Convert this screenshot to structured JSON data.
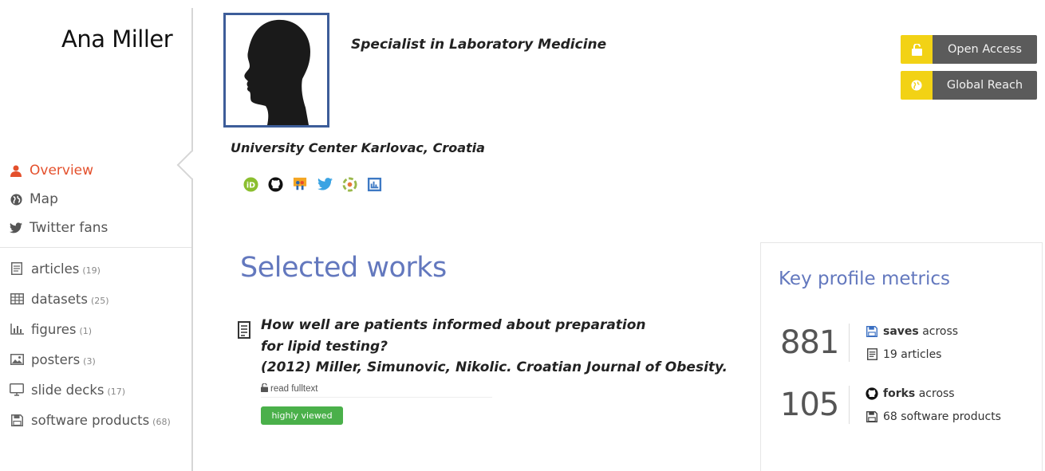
{
  "profile": {
    "name": "Ana Miller",
    "title": "Specialist in Laboratory Medicine",
    "affiliation": "University Center Karlovac, Croatia"
  },
  "social_icons": [
    "orcid-icon",
    "github-icon",
    "slideshare-icon",
    "twitter-icon",
    "zenodo-icon",
    "figshare-icon"
  ],
  "badges": [
    {
      "label": "Open Access",
      "icon": "open-lock-icon"
    },
    {
      "label": "Global Reach",
      "icon": "globe-icon"
    }
  ],
  "sidebar": {
    "nav": [
      {
        "label": "Overview",
        "icon": "user-icon",
        "active": true
      },
      {
        "label": "Map",
        "icon": "globe-icon",
        "active": false
      },
      {
        "label": "Twitter fans",
        "icon": "twitter-icon",
        "active": false
      }
    ],
    "products": [
      {
        "label": "articles",
        "count": "(19)",
        "icon": "article-icon"
      },
      {
        "label": "datasets",
        "count": "(25)",
        "icon": "table-icon"
      },
      {
        "label": "figures",
        "count": "(1)",
        "icon": "bar-chart-icon"
      },
      {
        "label": "posters",
        "count": "(3)",
        "icon": "image-icon"
      },
      {
        "label": "slide decks",
        "count": "(17)",
        "icon": "monitor-icon"
      },
      {
        "label": "software products",
        "count": "(68)",
        "icon": "floppy-icon"
      }
    ]
  },
  "selected_works": {
    "heading": "Selected works",
    "items": [
      {
        "line1": "How well are patients informed about preparation",
        "line2": "for lipid testing?",
        "line3": "(2012) Miller, Simunovic, Nikolic. Croatian Journal of Obesity.",
        "fulltext_label": "read fulltext",
        "tag": "highly viewed"
      }
    ]
  },
  "metrics": {
    "heading": "Key profile metrics",
    "rows": [
      {
        "value": "881",
        "top_bold": "saves",
        "top_rest": "across",
        "bottom": "19 articles",
        "top_icon": "save-icon",
        "bottom_icon": "article-icon"
      },
      {
        "value": "105",
        "top_bold": "forks",
        "top_rest": "across",
        "bottom": "68 software products",
        "top_icon": "github-icon",
        "bottom_icon": "floppy-icon"
      }
    ]
  },
  "colors": {
    "accent": "#e4502c",
    "heading_blue": "#6378be",
    "badge_yellow": "#f2d215",
    "badge_gray": "#5b5b5b",
    "tag_green": "#4ab04a",
    "photo_border": "#3d5d99"
  }
}
